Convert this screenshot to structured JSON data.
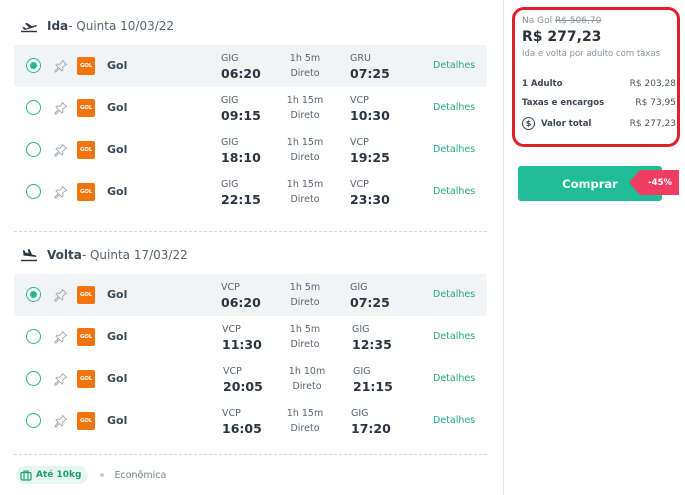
{
  "outbound": {
    "label": "Ida",
    "date": " - Quinta 10/03/22",
    "flights": [
      {
        "airline": "Gol",
        "logo": "GOL",
        "origin": "GIG",
        "depart": "06:20",
        "duration": "1h 5m",
        "stops": "Direto",
        "dest": "GRU",
        "arrive": "07:25",
        "details": "Detalhes",
        "selected": true
      },
      {
        "airline": "Gol",
        "logo": "GOL",
        "origin": "GIG",
        "depart": "09:15",
        "duration": "1h 15m",
        "stops": "Direto",
        "dest": "VCP",
        "arrive": "10:30",
        "details": "Detalhes",
        "selected": false
      },
      {
        "airline": "Gol",
        "logo": "GOL",
        "origin": "GIG",
        "depart": "18:10",
        "duration": "1h 15m",
        "stops": "Direto",
        "dest": "VCP",
        "arrive": "19:25",
        "details": "Detalhes",
        "selected": false
      },
      {
        "airline": "Gol",
        "logo": "GOL",
        "origin": "GIG",
        "depart": "22:15",
        "duration": "1h 15m",
        "stops": "Direto",
        "dest": "VCP",
        "arrive": "23:30",
        "details": "Detalhes",
        "selected": false
      }
    ]
  },
  "return": {
    "label": "Volta",
    "date": " - Quinta 17/03/22",
    "flights": [
      {
        "airline": "Gol",
        "logo": "GOL",
        "origin": "VCP",
        "depart": "06:20",
        "duration": "1h 5m",
        "stops": "Direto",
        "dest": "GIG",
        "arrive": "07:25",
        "details": "Detalhes",
        "selected": true
      },
      {
        "airline": "Gol",
        "logo": "GOL",
        "origin": "VCP",
        "depart": "11:30",
        "duration": "1h 5m",
        "stops": "Direto",
        "dest": "GIG",
        "arrive": "12:35",
        "details": "Detalhes",
        "selected": false
      },
      {
        "airline": "Gol",
        "logo": "GOL",
        "origin": "VCP",
        "depart": "20:05",
        "duration": "1h 10m",
        "stops": "Direto",
        "dest": "GIG",
        "arrive": "21:15",
        "details": "Detalhes",
        "selected": false
      },
      {
        "airline": "Gol",
        "logo": "GOL",
        "origin": "VCP",
        "depart": "16:05",
        "duration": "1h 15m",
        "stops": "Direto",
        "dest": "GIG",
        "arrive": "17:20",
        "details": "Detalhes",
        "selected": false
      }
    ]
  },
  "footer": {
    "baggage": "Até 10kg",
    "cabin": "Econômica"
  },
  "pricing": {
    "original_prefix": "Na Gol",
    "original_price": "R$ 506,70",
    "price": "R$ 277,23",
    "subtitle": "Ida e volta por adulto com taxas",
    "lines": [
      {
        "label": "1 Adulto",
        "value": "R$ 203,28"
      },
      {
        "label": "Taxas e encargos",
        "value": "R$ 73,95"
      },
      {
        "label": "Valor total",
        "value": "R$ 277,23"
      }
    ],
    "money_icon_glyph": "$",
    "buy_label": "Comprar",
    "discount": "-45%"
  },
  "colors": {
    "accent": "#1fbd95",
    "highlight_border": "#e0202a",
    "discount": "#f03d62",
    "airline_logo": "#f2740c"
  }
}
